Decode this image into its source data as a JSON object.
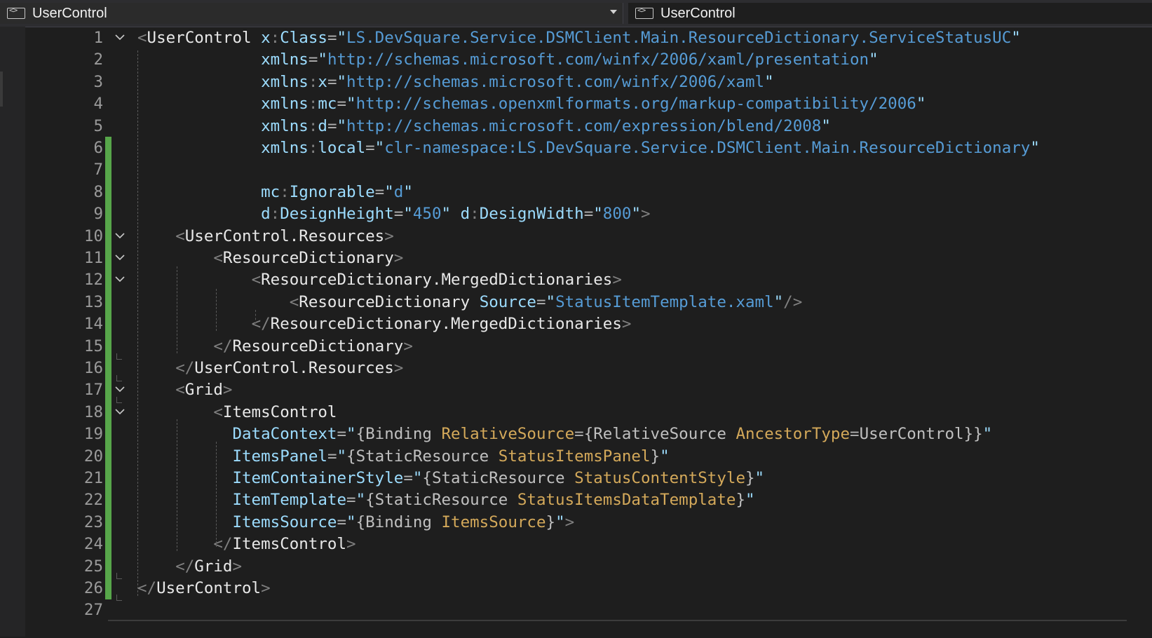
{
  "nav": {
    "left_label": "UserControl",
    "right_label": "UserControl",
    "icon": "xaml-element-icon"
  },
  "colors": {
    "background": "#1e1e1e",
    "line_number": "#9a9a9a",
    "change_bar": "#57a64a",
    "tag": "#e8e8e8",
    "attribute": "#9cdcfe",
    "string": "#569cd6",
    "markup_extension": "#d4a95a"
  },
  "lines": [
    {
      "num": "1",
      "text": "<UserControl x:Class=\"LS.DevSquare.Service.DSMClient.Main.ResourceDictionary.ServiceStatusUC\""
    },
    {
      "num": "2",
      "text": "             xmlns=\"http://schemas.microsoft.com/winfx/2006/xaml/presentation\""
    },
    {
      "num": "3",
      "text": "             xmlns:x=\"http://schemas.microsoft.com/winfx/2006/xaml\""
    },
    {
      "num": "4",
      "text": "             xmlns:mc=\"http://schemas.openxmlformats.org/markup-compatibility/2006\""
    },
    {
      "num": "5",
      "text": "             xmlns:d=\"http://schemas.microsoft.com/expression/blend/2008\""
    },
    {
      "num": "6",
      "text": "             xmlns:local=\"clr-namespace:LS.DevSquare.Service.DSMClient.Main.ResourceDictionary\""
    },
    {
      "num": "7",
      "text": ""
    },
    {
      "num": "8",
      "text": "             mc:Ignorable=\"d\""
    },
    {
      "num": "9",
      "text": "             d:DesignHeight=\"450\" d:DesignWidth=\"800\">"
    },
    {
      "num": "10",
      "text": "    <UserControl.Resources>"
    },
    {
      "num": "11",
      "text": "        <ResourceDictionary>"
    },
    {
      "num": "12",
      "text": "            <ResourceDictionary.MergedDictionaries>"
    },
    {
      "num": "13",
      "text": "                <ResourceDictionary Source=\"StatusItemTemplate.xaml\"/>"
    },
    {
      "num": "14",
      "text": "            </ResourceDictionary.MergedDictionaries>"
    },
    {
      "num": "15",
      "text": "        </ResourceDictionary>"
    },
    {
      "num": "16",
      "text": "    </UserControl.Resources>"
    },
    {
      "num": "17",
      "text": "    <Grid>"
    },
    {
      "num": "18",
      "text": "        <ItemsControl"
    },
    {
      "num": "19",
      "text": "          DataContext=\"{Binding RelativeSource={RelativeSource AncestorType=UserControl}}\""
    },
    {
      "num": "20",
      "text": "          ItemsPanel=\"{StaticResource StatusItemsPanel}\""
    },
    {
      "num": "21",
      "text": "          ItemContainerStyle=\"{StaticResource StatusContentStyle}\""
    },
    {
      "num": "22",
      "text": "          ItemTemplate=\"{StaticResource StatusItemsDataTemplate}\""
    },
    {
      "num": "23",
      "text": "          ItemsSource=\"{Binding ItemsSource}\">"
    },
    {
      "num": "24",
      "text": "        </ItemsControl>"
    },
    {
      "num": "25",
      "text": "    </Grid>"
    },
    {
      "num": "26",
      "text": "</UserControl>"
    },
    {
      "num": "27",
      "text": ""
    }
  ],
  "changed_lines": [
    "6",
    "7",
    "8",
    "9",
    "10",
    "11",
    "12",
    "13",
    "14",
    "15",
    "16",
    "17",
    "18",
    "19",
    "20",
    "21",
    "22",
    "23",
    "24",
    "25",
    "26"
  ],
  "folded_lines": [
    "1",
    "10",
    "11",
    "12",
    "17",
    "18"
  ]
}
